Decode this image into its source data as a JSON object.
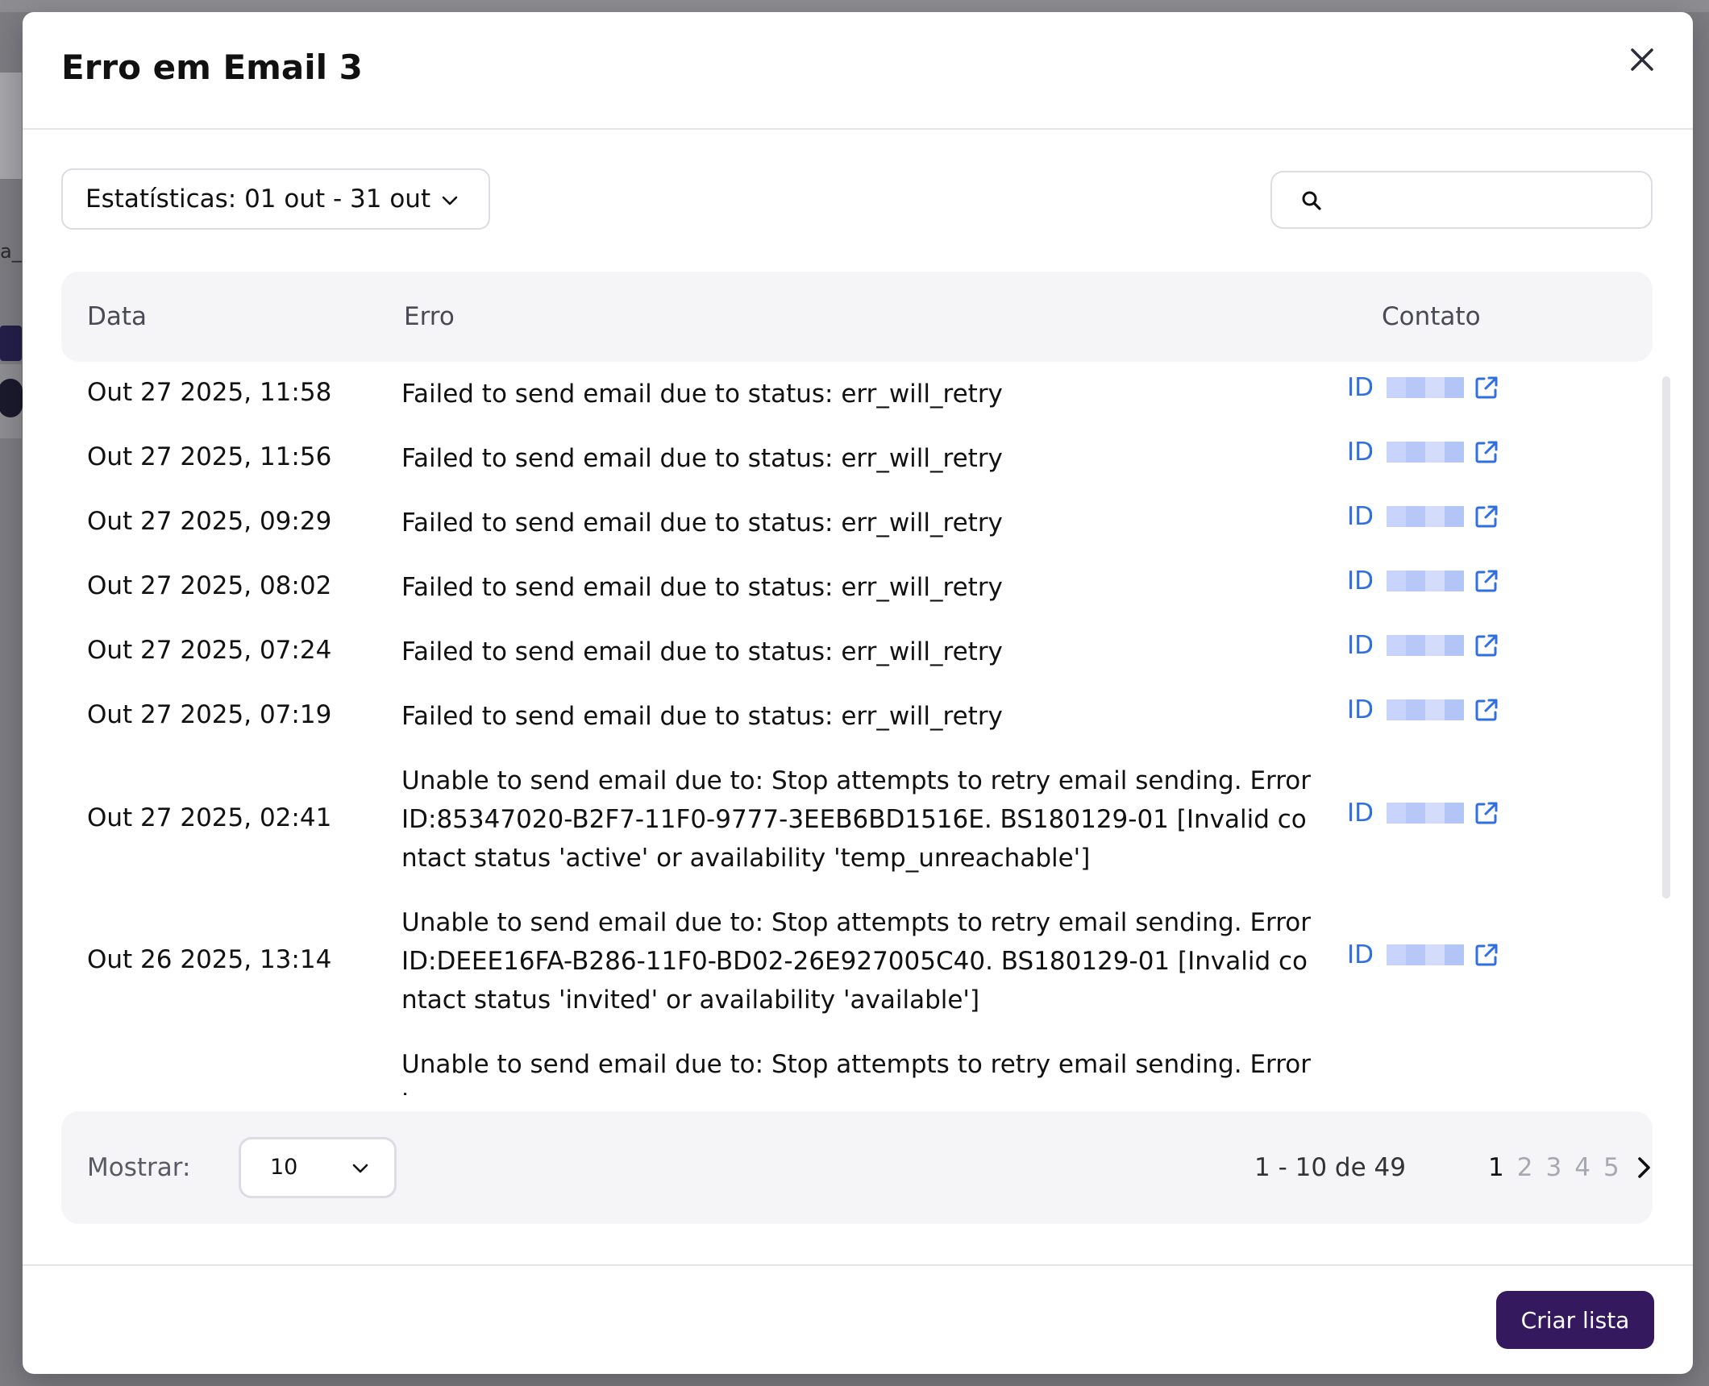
{
  "modal": {
    "title": "Erro em Email 3"
  },
  "filter": {
    "label": "Estatísticas: 01 out - 31 out"
  },
  "search": {
    "placeholder": "",
    "value": ""
  },
  "table": {
    "columns": [
      "Data",
      "Erro",
      "Contato"
    ],
    "contact_prefix": "ID",
    "rows": [
      {
        "date": "Out 27 2025, 11:58",
        "error": "Failed to send email due to status: err_will_retry"
      },
      {
        "date": "Out 27 2025, 11:56",
        "error": "Failed to send email due to status: err_will_retry"
      },
      {
        "date": "Out 27 2025, 09:29",
        "error": "Failed to send email due to status: err_will_retry"
      },
      {
        "date": "Out 27 2025, 08:02",
        "error": "Failed to send email due to status: err_will_retry"
      },
      {
        "date": "Out 27 2025, 07:24",
        "error": "Failed to send email due to status: err_will_retry"
      },
      {
        "date": "Out 27 2025, 07:19",
        "error": "Failed to send email due to status: err_will_retry"
      },
      {
        "date": "Out 27 2025, 02:41",
        "error": "Unable to send email due to: Stop attempts to retry email sending. Error ID:85347020-B2F7-11F0-9777-3EEB6BD1516E. BS180129-01 [Invalid contact status 'active' or availability 'temp_unreachable']"
      },
      {
        "date": "Out 26 2025, 13:14",
        "error": "Unable to send email due to: Stop attempts to retry email sending. Error ID:DEEE16FA-B286-11F0-BD02-26E927005C40. BS180129-01 [Invalid contact status 'invited' or availability 'available']"
      },
      {
        "date": "",
        "error": "Unable to send email due to: Stop attempts to retry email sending. Error I"
      }
    ]
  },
  "pagination": {
    "show_label": "Mostrar:",
    "page_size": "10",
    "range_text": "1 - 10 de 49",
    "pages": [
      "1",
      "2",
      "3",
      "4",
      "5"
    ],
    "current_page": "1"
  },
  "actions": {
    "create_list": "Criar lista"
  },
  "colors": {
    "primary": "#35195f",
    "link": "#2f6fe0"
  }
}
